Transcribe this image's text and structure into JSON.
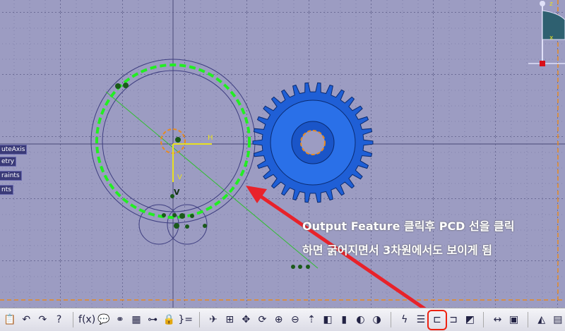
{
  "tree_labels": [
    "uteAxis",
    "etry",
    "raints",
    "nts"
  ],
  "sketch_labels": {
    "h": "H",
    "v": "V",
    "v2": "V"
  },
  "annotation": {
    "line1": "Output Feature 클릭후 PCD 선을 클릭",
    "line2": "하면 굵어지면서 3차원에서도 보이게 됨"
  },
  "compass": {
    "z": "z",
    "x": "x"
  },
  "colors": {
    "background": "#9c9cc2",
    "gear": "#1f5fd6",
    "pcd": "#22ee22",
    "arrow": "#e8222a"
  },
  "toolbar": [
    {
      "icon": "paste-icon",
      "glyph": "📋"
    },
    {
      "icon": "undo-icon",
      "glyph": "↶"
    },
    {
      "icon": "redo-icon",
      "glyph": "↷"
    },
    {
      "icon": "whats-this-icon",
      "glyph": "?"
    },
    {
      "sep": true
    },
    {
      "icon": "formula-icon",
      "glyph": "f(x)"
    },
    {
      "icon": "knowledge-advisor-icon",
      "glyph": "💬"
    },
    {
      "icon": "link-icon",
      "glyph": "⚭"
    },
    {
      "icon": "design-table-icon",
      "glyph": "▦"
    },
    {
      "icon": "tree-icon",
      "glyph": "⊶"
    },
    {
      "icon": "lock-icon",
      "glyph": "🔒"
    },
    {
      "icon": "equations-icon",
      "glyph": "}="
    },
    {
      "sep": true
    },
    {
      "icon": "fly-mode-icon",
      "glyph": "✈"
    },
    {
      "icon": "fit-all-icon",
      "glyph": "⊞"
    },
    {
      "icon": "pan-icon",
      "glyph": "✥"
    },
    {
      "icon": "rotate-icon",
      "glyph": "⟳"
    },
    {
      "icon": "zoom-in-icon",
      "glyph": "⊕"
    },
    {
      "icon": "zoom-out-icon",
      "glyph": "⊖"
    },
    {
      "icon": "normal-view-icon",
      "glyph": "⇡"
    },
    {
      "icon": "iso-view-icon",
      "glyph": "◧"
    },
    {
      "icon": "render-style-icon",
      "glyph": "▮"
    },
    {
      "icon": "hide-show-icon",
      "glyph": "◐"
    },
    {
      "icon": "swap-space-icon",
      "glyph": "◑"
    },
    {
      "sep": true
    },
    {
      "icon": "constraint-icon",
      "glyph": "ϟ"
    },
    {
      "icon": "list-icon",
      "glyph": "☰"
    },
    {
      "icon": "output-feature-icon",
      "glyph": "⊏",
      "highlight": true
    },
    {
      "icon": "profile-feature-icon",
      "glyph": "⊐"
    },
    {
      "icon": "sketch-analysis-icon",
      "glyph": "◩"
    },
    {
      "sep": true
    },
    {
      "icon": "measure-icon",
      "glyph": "↔"
    },
    {
      "icon": "inertia-icon",
      "glyph": "▣"
    },
    {
      "sep": true
    },
    {
      "icon": "apply-material-icon",
      "glyph": "◭"
    },
    {
      "icon": "catalog-icon",
      "glyph": "▤"
    }
  ]
}
